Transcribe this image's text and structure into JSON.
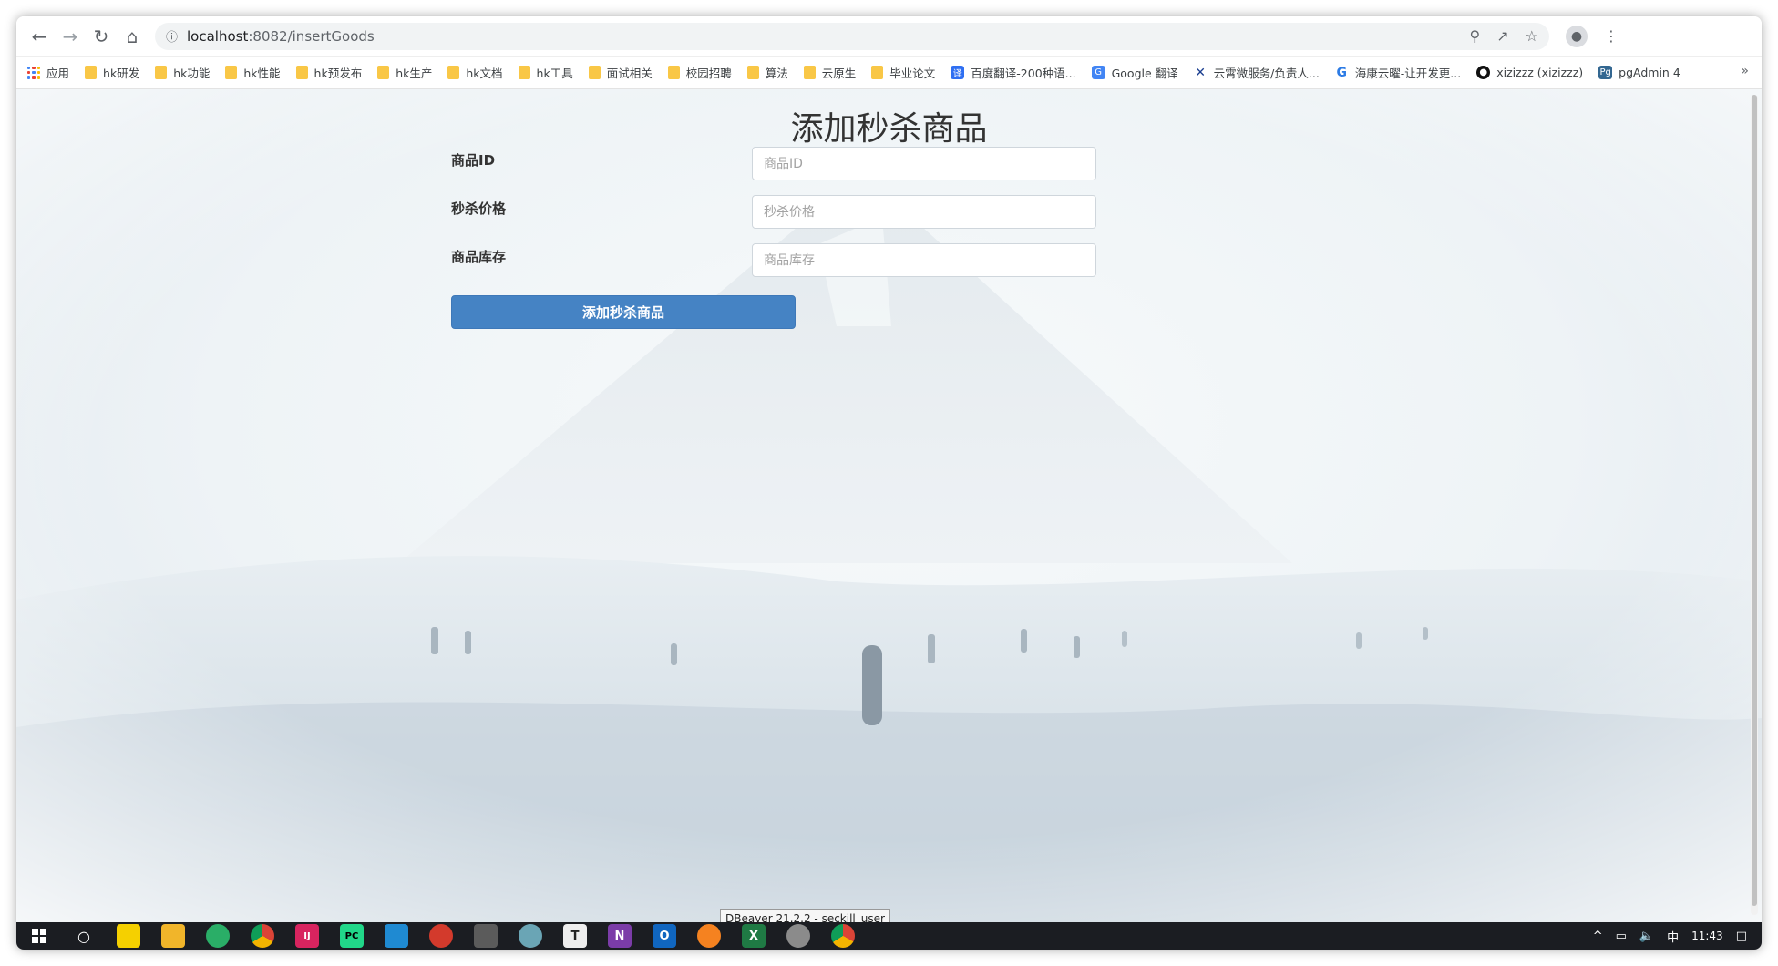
{
  "browser": {
    "url_host": "localhost",
    "url_path": ":8082/insertGoods"
  },
  "bookmarks": {
    "apps_label": "应用",
    "items": [
      {
        "label": "hk研发"
      },
      {
        "label": "hk功能"
      },
      {
        "label": "hk性能"
      },
      {
        "label": "hk预发布"
      },
      {
        "label": "hk生产"
      },
      {
        "label": "hk文档"
      },
      {
        "label": "hk工具"
      },
      {
        "label": "面试相关"
      },
      {
        "label": "校园招聘"
      },
      {
        "label": "算法"
      },
      {
        "label": "云原生"
      },
      {
        "label": "毕业论文"
      }
    ],
    "links": [
      {
        "label": "百度翻译-200种语...",
        "icon": "baidu-translate-icon",
        "color": "#2f6ff2"
      },
      {
        "label": "Google 翻译",
        "icon": "google-translate-icon",
        "color": "#4285f4"
      },
      {
        "label": "云霄微服务/负责人...",
        "icon": "x-icon",
        "color": "#1a3d8f"
      },
      {
        "label": "海康云曜-让开发更...",
        "icon": "g-icon",
        "color": "#2c7be5"
      },
      {
        "label": "xizizzz (xizizzz)",
        "icon": "github-icon",
        "color": "#111111"
      },
      {
        "label": "pgAdmin 4",
        "icon": "pgadmin-icon",
        "color": "#336791"
      }
    ],
    "more": "»"
  },
  "page": {
    "title": "添加秒杀商品",
    "fields": [
      {
        "label": "商品ID",
        "placeholder": "商品ID",
        "value": ""
      },
      {
        "label": "秒杀价格",
        "placeholder": "秒杀价格",
        "value": ""
      },
      {
        "label": "商品库存",
        "placeholder": "商品库存",
        "value": ""
      }
    ],
    "submit_label": "添加秒杀商品",
    "accent_color": "#4583c4"
  },
  "tooltip": "DBeaver 21.2.2 - seckill_user",
  "taskbar": {
    "apps": [
      {
        "name": "search-icon",
        "color": "transparent",
        "glyph": "○"
      },
      {
        "name": "sticky-notes-icon",
        "color": "#f5d000",
        "glyph": ""
      },
      {
        "name": "file-explorer-icon",
        "color": "#f1b52a",
        "glyph": ""
      },
      {
        "name": "wechat-icon",
        "color": "#2aae67",
        "glyph": ""
      },
      {
        "name": "chrome-icon",
        "color": "#db4437",
        "glyph": ""
      },
      {
        "name": "intellij-icon",
        "color": "#d8245f",
        "glyph": "IJ"
      },
      {
        "name": "pycharm-icon",
        "color": "#21d789",
        "glyph": "PC"
      },
      {
        "name": "vscode-icon",
        "color": "#1f8ad2",
        "glyph": ""
      },
      {
        "name": "app-red-icon",
        "color": "#d33a2c",
        "glyph": ""
      },
      {
        "name": "app-gray-icon",
        "color": "#5b5b5b",
        "glyph": ""
      },
      {
        "name": "app-teal-icon",
        "color": "#6aa5b5",
        "glyph": ""
      },
      {
        "name": "typora-icon",
        "color": "#eeeeee",
        "glyph": "T"
      },
      {
        "name": "onenote-icon",
        "color": "#7b3ca8",
        "glyph": "N"
      },
      {
        "name": "outlook-icon",
        "color": "#1066c0",
        "glyph": "O"
      },
      {
        "name": "sublime-icon",
        "color": "#f58220",
        "glyph": ""
      },
      {
        "name": "excel-icon",
        "color": "#1f7a44",
        "glyph": "X"
      },
      {
        "name": "dbeaver-icon",
        "color": "#8b8b8b",
        "glyph": ""
      },
      {
        "name": "chrome-active-icon",
        "color": "#db4437",
        "glyph": ""
      }
    ],
    "tray": {
      "chevron": "^",
      "ime": "中",
      "time": "11:43"
    }
  }
}
